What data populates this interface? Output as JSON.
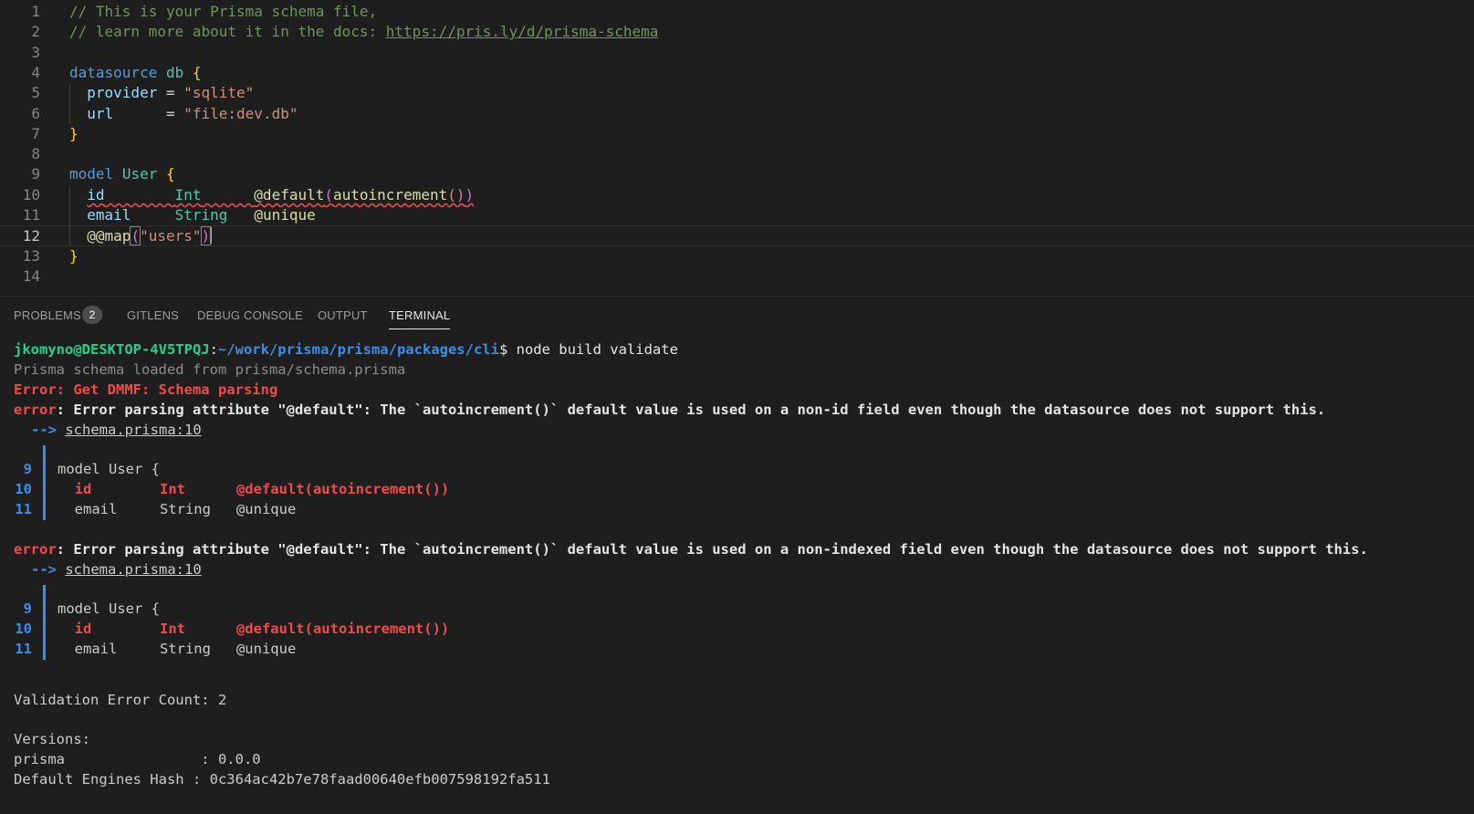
{
  "editor": {
    "lines": [
      {
        "n": "1",
        "tokens": [
          {
            "t": "// This is your Prisma schema file,",
            "c": "c-com"
          }
        ]
      },
      {
        "n": "2",
        "tokens": [
          {
            "t": "// learn more about it in the docs: ",
            "c": "c-com"
          },
          {
            "t": "https://pris.ly/d/prisma-schema",
            "c": "c-link"
          }
        ]
      },
      {
        "n": "3",
        "tokens": []
      },
      {
        "n": "4",
        "tokens": [
          {
            "t": "datasource",
            "c": "c-kw"
          },
          {
            "t": " "
          },
          {
            "t": "db",
            "c": "c-type"
          },
          {
            "t": " "
          },
          {
            "t": "{",
            "c": "c-brace"
          }
        ]
      },
      {
        "n": "5",
        "tokens": [
          {
            "t": "  "
          },
          {
            "t": "provider",
            "c": "c-var"
          },
          {
            "t": " = "
          },
          {
            "t": "\"sqlite\"",
            "c": "c-str"
          }
        ]
      },
      {
        "n": "6",
        "tokens": [
          {
            "t": "  "
          },
          {
            "t": "url",
            "c": "c-var"
          },
          {
            "t": "      = "
          },
          {
            "t": "\"file:dev.db\"",
            "c": "c-str"
          }
        ]
      },
      {
        "n": "7",
        "tokens": [
          {
            "t": "}",
            "c": "c-brace"
          }
        ]
      },
      {
        "n": "8",
        "tokens": []
      },
      {
        "n": "9",
        "tokens": [
          {
            "t": "model",
            "c": "c-kw"
          },
          {
            "t": " "
          },
          {
            "t": "User",
            "c": "c-type"
          },
          {
            "t": " "
          },
          {
            "t": "{",
            "c": "c-brace"
          }
        ]
      },
      {
        "n": "10",
        "tokens": [
          {
            "t": "  "
          },
          {
            "t": "id",
            "c": "c-var squiggle"
          },
          {
            "t": "        ",
            "c": "squiggle"
          },
          {
            "t": "Int",
            "c": "c-type squiggle"
          },
          {
            "t": "      ",
            "c": "squiggle"
          },
          {
            "t": "@default",
            "c": "c-attr squiggle"
          },
          {
            "t": "(",
            "c": "c-paren squiggle"
          },
          {
            "t": "autoincrement",
            "c": "c-attr squiggle"
          },
          {
            "t": "()",
            "c": "c-str squiggle"
          },
          {
            "t": ")",
            "c": "c-paren squiggle"
          }
        ]
      },
      {
        "n": "11",
        "tokens": [
          {
            "t": "  "
          },
          {
            "t": "email",
            "c": "c-var"
          },
          {
            "t": "     "
          },
          {
            "t": "String",
            "c": "c-type"
          },
          {
            "t": "   "
          },
          {
            "t": "@unique",
            "c": "c-attr"
          }
        ]
      },
      {
        "n": "12",
        "tokens": [
          {
            "t": "  "
          },
          {
            "t": "@@map",
            "c": "c-attr"
          },
          {
            "t": "(",
            "c": "c-paren brk"
          },
          {
            "t": "\"users\"",
            "c": "c-str"
          },
          {
            "t": ")",
            "c": "c-paren brk"
          }
        ],
        "cursor": true,
        "active": true
      },
      {
        "n": "13",
        "tokens": [
          {
            "t": "}",
            "c": "c-brace"
          }
        ]
      },
      {
        "n": "14",
        "tokens": []
      }
    ]
  },
  "panel": {
    "tabs": [
      {
        "label": "PROBLEMS",
        "active": false
      },
      {
        "label": "GITLENS",
        "active": false
      },
      {
        "label": "DEBUG CONSOLE",
        "active": false
      },
      {
        "label": "OUTPUT",
        "active": false
      },
      {
        "label": "TERMINAL",
        "active": true
      }
    ],
    "problems_count": "2"
  },
  "terminal": {
    "prompt_user": "jkomyno@DESKTOP-4V5TPQJ",
    "prompt_path": "~/work/prisma/prisma/packages/cli",
    "command": "node build validate",
    "loaded": "Prisma schema loaded from prisma/schema.prisma",
    "error_title": "Error: Get DMMF: Schema parsing",
    "errors": [
      {
        "label": "error",
        "message": "Error parsing attribute \"@default\": The `autoincrement()` default value is used on a non-id field even though the datasource does not support this.",
        "arrow": "-->",
        "location": "schema.prisma:10",
        "snippet": [
          {
            "n": "9",
            "text": "model User {",
            "highlight": false
          },
          {
            "n": "10",
            "text": "  id        Int      @default(autoincrement())",
            "highlight": true
          },
          {
            "n": "11",
            "text": "  email     String   @unique",
            "highlight": false
          }
        ]
      },
      {
        "label": "error",
        "message": "Error parsing attribute \"@default\": The `autoincrement()` default value is used on a non-indexed field even though the datasource does not support this.",
        "arrow": "-->",
        "location": "schema.prisma:10",
        "snippet": [
          {
            "n": "9",
            "text": "model User {",
            "highlight": false
          },
          {
            "n": "10",
            "text": "  id        Int      @default(autoincrement())",
            "highlight": true
          },
          {
            "n": "11",
            "text": "  email     String   @unique",
            "highlight": false
          }
        ]
      }
    ],
    "validation_count": "Validation Error Count: 2",
    "versions_header": "Versions:",
    "prisma_version": "prisma                : 0.0.0",
    "engines_hash": "Default Engines Hash : 0c364ac42b7e78faad00640efb007598192fa511"
  }
}
